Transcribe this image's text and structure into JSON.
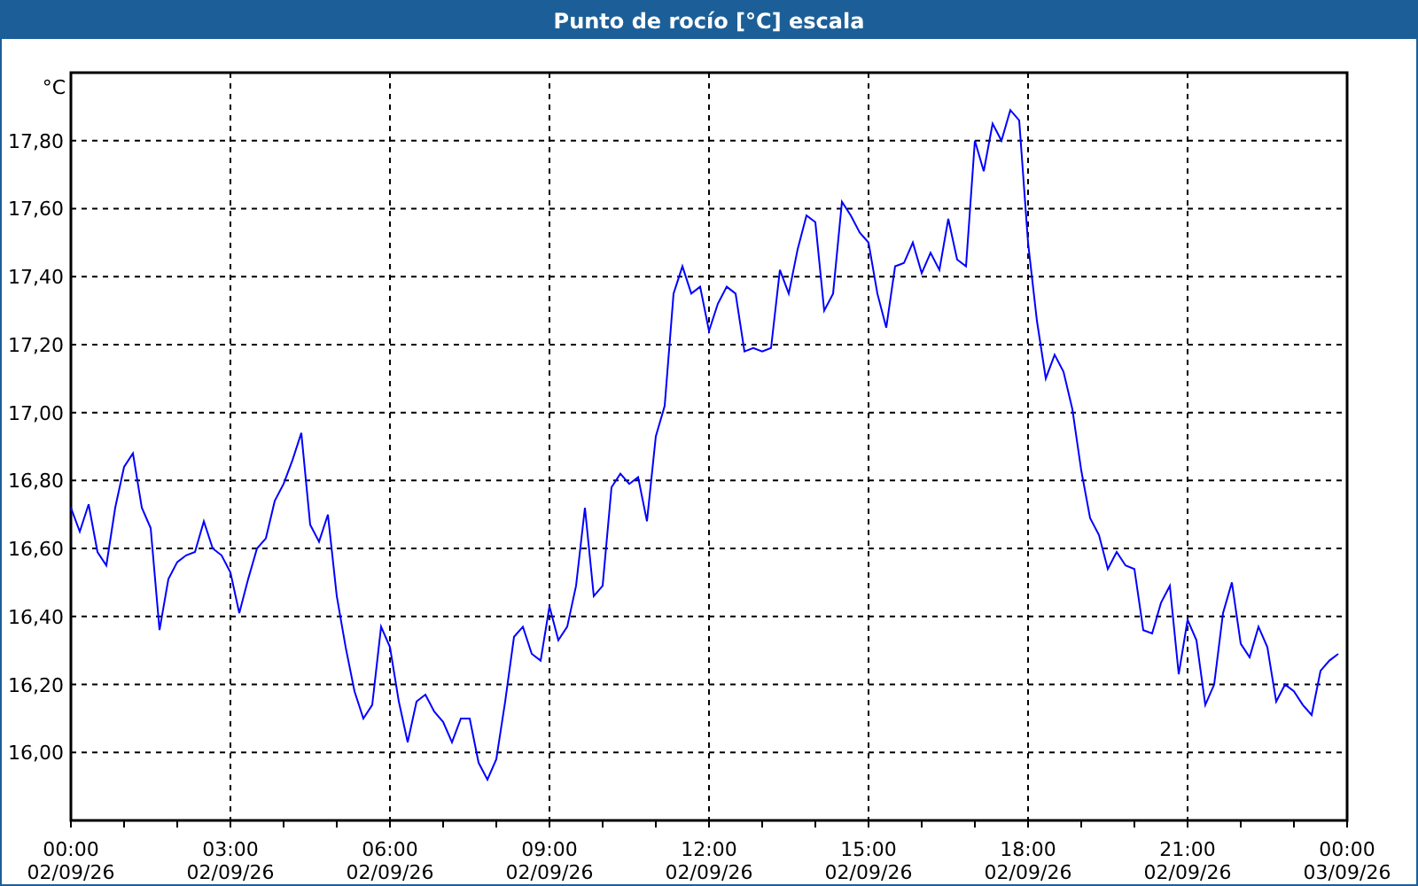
{
  "window": {
    "title": "Punto de rocío [°C] escala"
  },
  "chart": {
    "chart_data": {
      "type": "line",
      "ylabel": "°C",
      "grid": true,
      "ylim": [
        15.8,
        18.0
      ],
      "categories": [
        "00:00\n02/09/26",
        null,
        null,
        null,
        null,
        null,
        null,
        null,
        null,
        null,
        null,
        null,
        null,
        null,
        null,
        null,
        null,
        null,
        "03:00\n02/09/26",
        null,
        null,
        null,
        null,
        null,
        null,
        null,
        null,
        null,
        null,
        null,
        null,
        null,
        null,
        null,
        null,
        null,
        "06:00\n02/09/26",
        null,
        null,
        null,
        null,
        null,
        null,
        null,
        null,
        null,
        null,
        null,
        null,
        null,
        null,
        null,
        null,
        null,
        "09:00\n02/09/26",
        null,
        null,
        null,
        null,
        null,
        null,
        null,
        null,
        null,
        null,
        null,
        null,
        null,
        null,
        null,
        null,
        null,
        "12:00\n02/09/26",
        null,
        null,
        null,
        null,
        null,
        null,
        null,
        null,
        null,
        null,
        null,
        null,
        null,
        null,
        null,
        null,
        null,
        "15:00\n02/09/26",
        null,
        null,
        null,
        null,
        null,
        null,
        null,
        null,
        null,
        null,
        null,
        null,
        null,
        null,
        null,
        null,
        null,
        "18:00\n02/09/26",
        null,
        null,
        null,
        null,
        null,
        null,
        null,
        null,
        null,
        null,
        null,
        null,
        null,
        null,
        null,
        null,
        null,
        "21:00\n02/09/26",
        null,
        null,
        null,
        null,
        null,
        null,
        null,
        null,
        null,
        null,
        null,
        null,
        null,
        null,
        null,
        null,
        null,
        "00:00\n03/09/26"
      ],
      "yticks": [
        {
          "value": 16.0,
          "label": "16,00"
        },
        {
          "value": 16.2,
          "label": "16,20"
        },
        {
          "value": 16.4,
          "label": "16,40"
        },
        {
          "value": 16.6,
          "label": "16,60"
        },
        {
          "value": 16.8,
          "label": "16,80"
        },
        {
          "value": 17.0,
          "label": "17,00"
        },
        {
          "value": 17.2,
          "label": "17,20"
        },
        {
          "value": 17.4,
          "label": "17,40"
        },
        {
          "value": 17.6,
          "label": "17,60"
        },
        {
          "value": 17.8,
          "label": "17,80"
        }
      ],
      "series": [
        {
          "color": "#0000ff",
          "values": [
            16.72,
            16.65,
            16.73,
            16.59,
            16.55,
            16.72,
            16.84,
            16.88,
            16.72,
            16.66,
            16.36,
            16.51,
            16.56,
            16.58,
            16.59,
            16.68,
            16.6,
            16.58,
            16.53,
            16.41,
            16.51,
            16.6,
            16.63,
            16.74,
            16.79,
            16.86,
            16.94,
            16.67,
            16.62,
            16.7,
            16.46,
            16.31,
            16.18,
            16.1,
            16.14,
            16.37,
            16.31,
            16.15,
            16.03,
            16.15,
            16.17,
            16.12,
            16.09,
            16.03,
            16.1,
            16.1,
            15.97,
            15.92,
            15.98,
            16.15,
            16.34,
            16.37,
            16.29,
            16.27,
            16.43,
            16.33,
            16.37,
            16.49,
            16.72,
            16.46,
            16.49,
            16.78,
            16.82,
            16.79,
            16.81,
            16.68,
            16.93,
            17.02,
            17.35,
            17.43,
            17.35,
            17.37,
            17.24,
            17.32,
            17.37,
            17.35,
            17.18,
            17.19,
            17.18,
            17.19,
            17.42,
            17.35,
            17.48,
            17.58,
            17.56,
            17.3,
            17.35,
            17.62,
            17.58,
            17.53,
            17.5,
            17.35,
            17.25,
            17.43,
            17.44,
            17.5,
            17.41,
            17.47,
            17.42,
            17.57,
            17.45,
            17.43,
            17.8,
            17.71,
            17.85,
            17.8,
            17.89,
            17.86,
            17.5,
            17.27,
            17.1,
            17.17,
            17.12,
            17.01,
            16.83,
            16.69,
            16.64,
            16.54,
            16.59,
            16.55,
            16.54,
            16.36,
            16.35,
            16.44,
            16.49,
            16.23,
            16.39,
            16.33,
            16.14,
            16.2,
            16.41,
            16.5,
            16.32,
            16.28,
            16.37,
            16.31,
            16.15,
            16.2,
            16.18,
            16.14,
            16.11,
            16.24,
            16.27,
            16.29,
            null
          ]
        }
      ]
    }
  }
}
